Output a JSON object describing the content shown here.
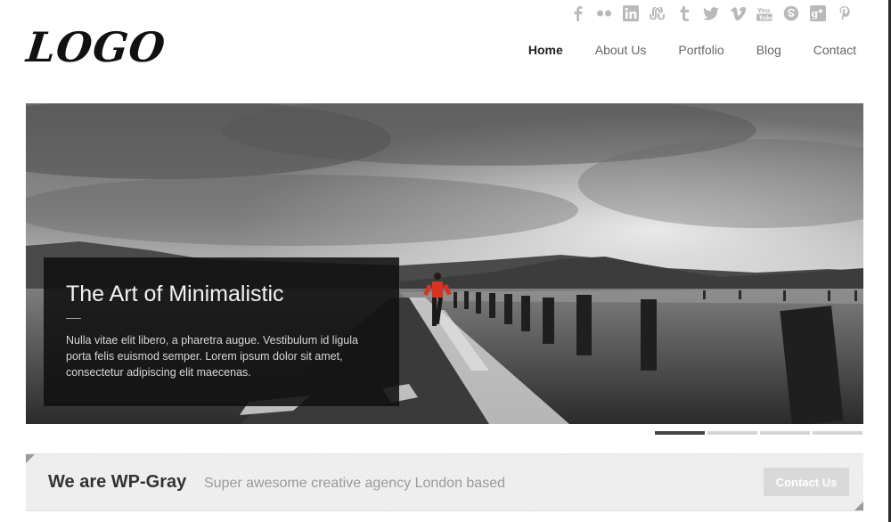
{
  "brand": {
    "logo_text": "LOGO"
  },
  "social_icons": [
    "facebook-icon",
    "flickr-icon",
    "linkedin-icon",
    "stumbleupon-icon",
    "tumblr-icon",
    "twitter-icon",
    "vimeo-icon",
    "youtube-icon",
    "skype-icon",
    "google-plus-icon",
    "pinterest-icon"
  ],
  "nav": {
    "items": [
      {
        "label": "Home",
        "active": true
      },
      {
        "label": "About Us",
        "active": false
      },
      {
        "label": "Portfolio",
        "active": false
      },
      {
        "label": "Blog",
        "active": false
      },
      {
        "label": "Contact",
        "active": false
      }
    ]
  },
  "hero": {
    "title": "The Art of Minimalistic",
    "text": "Nulla vitae elit libero, a pharetra augue. Vestibulum id ligula porta felis euismod semper. Lorem ipsum dolor sit amet, consectetur adipiscing elit maecenas.",
    "slides_total": 4,
    "active_slide": 1
  },
  "callout": {
    "heading": "We are WP-Gray",
    "tagline": "Super awesome creative agency London based",
    "button_label": "Contact Us"
  },
  "colors": {
    "accent_runner": "#d9331f",
    "caption_bg": "#101010"
  }
}
